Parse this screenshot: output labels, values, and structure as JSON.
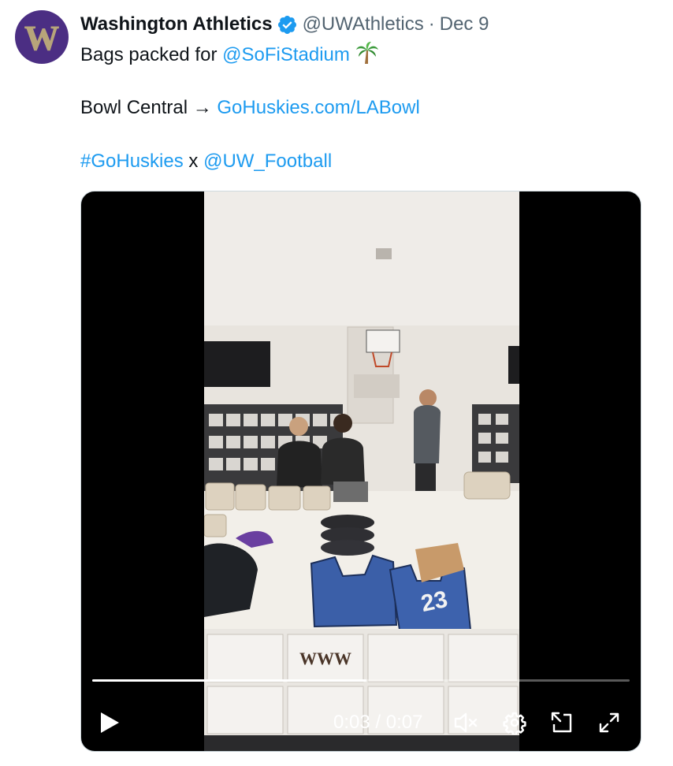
{
  "tweet": {
    "author": {
      "display_name": "Washington Athletics",
      "handle": "@UWAthletics",
      "separator": "·",
      "timestamp": "Dec 9",
      "avatar_icon": "uw-w-logo-icon",
      "verified_icon": "verified-badge-icon"
    },
    "text": {
      "line1_prefix": "Bags packed for ",
      "line1_link": "@SoFiStadium",
      "line1_emoji": "palm-tree-icon",
      "line2_prefix": "Bowl Central → ",
      "line2_link": "GoHuskies.com/LABowl",
      "line3_hashtag": "#GoHuskies",
      "line3_mid": " x ",
      "line3_link": "@UW_Football"
    },
    "video": {
      "progress_percent": 51,
      "time_display": "0:03 / 0:07",
      "jersey_number": "23",
      "controls": {
        "play_icon": "play-icon",
        "mute_icon": "speaker-muted-icon",
        "settings_icon": "gear-icon",
        "dock_icon": "dock-icon",
        "fullscreen_icon": "fullscreen-expand-icon"
      }
    },
    "colors": {
      "link": "#1d9bf0",
      "muted_text": "#536471",
      "uw_purple": "#4b2e83",
      "verified": "#1d9bf0"
    }
  }
}
